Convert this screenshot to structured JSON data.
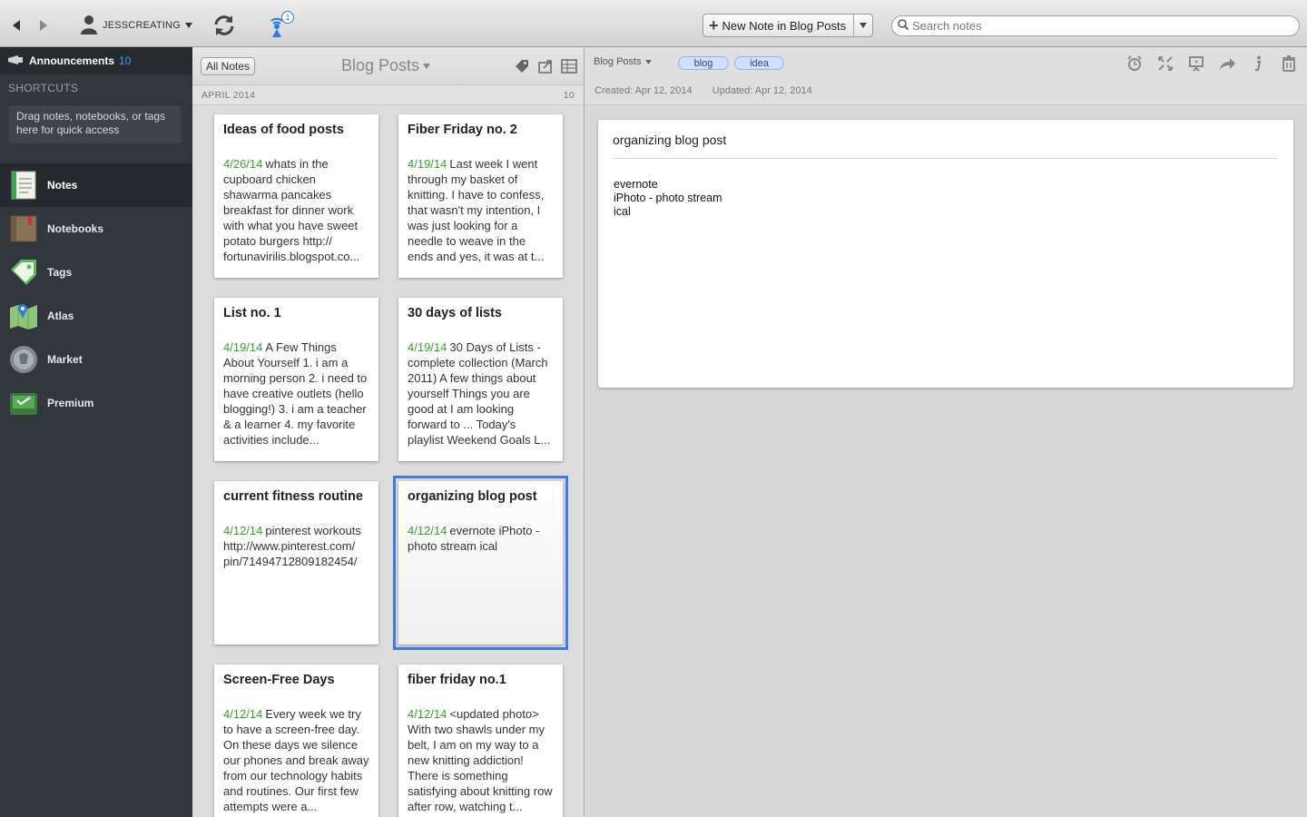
{
  "toolbar": {
    "back_icon": "back-arrow-icon",
    "forward_icon": "forward-arrow-icon",
    "account_name": "JESSCREATING",
    "sync_icon": "sync-icon",
    "activity_badge": "1",
    "new_note_label": "New Note in Blog Posts",
    "search_placeholder": "Search notes"
  },
  "sidebar": {
    "announcements_label": "Announcements",
    "announcements_count": "10",
    "shortcuts_heading": "SHORTCUTS",
    "shortcuts_hint": "Drag notes, notebooks, or tags here for quick access",
    "items": [
      {
        "label": "Notes",
        "icon": "notes-icon",
        "active": true
      },
      {
        "label": "Notebooks",
        "icon": "notebooks-icon"
      },
      {
        "label": "Tags",
        "icon": "tags-icon"
      },
      {
        "label": "Atlas",
        "icon": "atlas-icon"
      },
      {
        "label": "Market",
        "icon": "market-icon"
      },
      {
        "label": "Premium",
        "icon": "premium-icon"
      }
    ]
  },
  "notelist": {
    "all_notes_label": "All Notes",
    "notebook_title": "Blog Posts",
    "month_label": "APRIL 2014",
    "month_count": "10",
    "notes": [
      {
        "title": "Ideas of food posts",
        "date": "4/26/14",
        "snippet": "whats in the cupboard chicken shawarma pancakes breakfast for dinner work with what you have sweet potato burgers http:// fortunavirilis.blogspot.co..."
      },
      {
        "title": "Fiber Friday no. 2",
        "date": "4/19/14",
        "snippet": "Last week I went through my basket of knitting. I have to confess, that wasn't my intention, I was just looking for a needle to weave in the ends and yes, it was at t..."
      },
      {
        "title": "List no. 1",
        "date": "4/19/14",
        "snippet": "A Few Things About Yourself 1. i am a morning person 2. i need to have creative outlets (hello blogging!) 3. i am a teacher & a learner 4. my favorite activities include..."
      },
      {
        "title": "30 days of lists",
        "date": "4/19/14",
        "snippet": "30 Days of Lists - complete collection (March 2011) A few things about yourself Things you are good at I am looking forward to ... Today's playlist Weekend Goals L..."
      },
      {
        "title": "current fitness routine",
        "date": "4/12/14",
        "snippet": "pinterest workouts http://www.pinterest.com/ pin/71494712809182454/"
      },
      {
        "title": "organizing blog post",
        "date": "4/12/14",
        "snippet": "evernote iPhoto - photo stream ical",
        "selected": true
      },
      {
        "title": "Screen-Free Days",
        "date": "4/12/14",
        "snippet": "Every week we try to have a screen-free day. On these days we silence our phones and break away from our technology habits and routines. Our first few attempts were a..."
      },
      {
        "title": "fiber friday no.1",
        "date": "4/12/14",
        "snippet": "<updated photo> With two shawls under my belt, I am on my way to a new knitting addiction! There is something satisfying about knitting row after row, watching t..."
      }
    ]
  },
  "editor": {
    "notebook": "Blog Posts",
    "tags": [
      "blog",
      "idea"
    ],
    "created": "Created: Apr 12, 2014",
    "updated": "Updated: Apr 12, 2014",
    "title": "organizing blog post",
    "body_lines": [
      "evernote",
      "iPhoto - photo stream",
      "ical"
    ],
    "colors": {
      "accent": "#3f7ae6",
      "date_green": "#3a9c2e",
      "sidebar": "#32373d"
    }
  }
}
